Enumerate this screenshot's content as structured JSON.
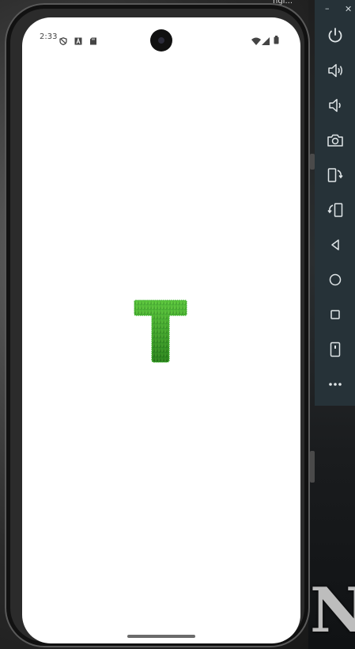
{
  "desktop": {
    "window_title_fragment": "ngl...",
    "background_art_text": "NIT"
  },
  "status_bar": {
    "time": "2:33",
    "left_icons": [
      "shield-icon",
      "a-box-icon",
      "sd-card-icon"
    ],
    "right_icons": [
      "wifi-icon",
      "cell-signal-icon",
      "battery-icon"
    ]
  },
  "app": {
    "content_letter": "T",
    "letter_style": "grass-textured"
  },
  "emulator_toolbar": {
    "minimize_label": "–",
    "close_label": "✕",
    "buttons": [
      "power-icon",
      "volume-up-icon",
      "volume-down-icon",
      "camera-icon",
      "rotate-left-icon",
      "rotate-right-icon",
      "back-icon",
      "home-icon",
      "overview-icon",
      "fold-icon",
      "more-icon"
    ]
  },
  "colors": {
    "toolbar_bg": "#263238",
    "grass_green": "#2e9a1f",
    "screen_bg": "#ffffff"
  }
}
